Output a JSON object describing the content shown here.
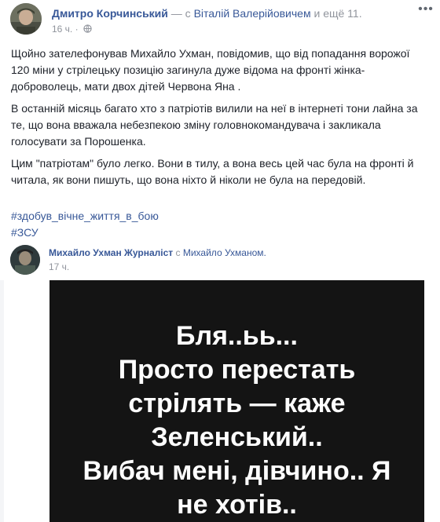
{
  "post": {
    "author": "Дмитро Корчинський",
    "with_text": "— с",
    "tagged": "Віталій Валерійовичем",
    "others": "и ещё 11.",
    "time": "16 ч.",
    "privacy_icon": "globe-icon",
    "more_icon": "more-horizontal-icon",
    "paragraphs": [
      "Щойно зателефонував Михайло Ухман, повідомив, що від попадання ворожої 120 міни у стрілецьку позицію загинула дуже відома на фронті жінка-доброволець, мати двох дітей Червона Яна .",
      "В останній місяць багато хто з патріотів вилили на неї в інтернеті тони лайна за те, що вона вважала небезпекою зміну головнокомандувача і закликала голосувати за Порошенка.",
      "Цим \"патріотам\" було легко. Вони в тилу, а вона весь цей час була на фронті й читала, як вони пишуть, що вона ніхто й ніколи не була на передовій."
    ],
    "hashtags": [
      "#здобув_вічне_життя_в_бою",
      "#ЗСУ"
    ]
  },
  "shared": {
    "author": "Михайло Ухман Журналіст",
    "with_text": "с",
    "tagged": "Михайло Ухманом.",
    "time": "17 ч."
  },
  "image": {
    "lines": [
      "Бля..ьь...",
      "Просто перестать",
      "стрілять — каже",
      "Зеленський..",
      "Вибач мені, дівчино.. Я",
      "не хотів.."
    ],
    "background": "#141414"
  },
  "colors": {
    "link": "#385898",
    "meta": "#90949c",
    "text": "#1d2129"
  }
}
